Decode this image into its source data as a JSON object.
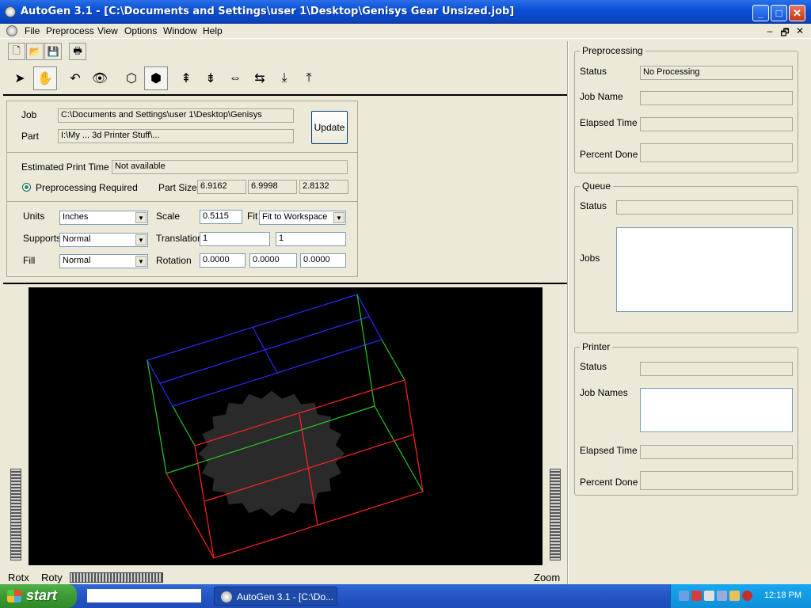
{
  "window": {
    "title": "AutoGen 3.1 - [C:\\Documents and Settings\\user 1\\Desktop\\Genisys          Gear Unsized.job]",
    "minimize": "_",
    "maximize": "□",
    "close": "✕"
  },
  "menu": {
    "items": [
      "File",
      "Preprocess",
      "View",
      "Options",
      "Window",
      "Help"
    ],
    "mdi_controls": [
      "–",
      "🗗",
      "✕"
    ]
  },
  "job_panel": {
    "job_label": "Job",
    "job_value": "C:\\Documents and Settings\\user 1\\Desktop\\Genisys",
    "part_label": "Part",
    "part_value": "I:\\My ... 3d Printer Stuff\\...",
    "update_label": "Update",
    "est_time_label": "Estimated Print Time",
    "est_time_value": "Not available",
    "preproc_label": "Preprocessing Required",
    "part_size_label": "Part Size",
    "part_size": [
      "6.9162",
      "6.9998",
      "2.8132"
    ],
    "units_label": "Units",
    "units_value": "Inches",
    "supports_label": "Supports",
    "supports_value": "Normal",
    "fill_label": "Fill",
    "fill_value": "Normal",
    "scale_label": "Scale",
    "scale_value": "0.5115",
    "fit_label": "Fit",
    "fit_value": "Fit to Workspace",
    "translation_label": "Translation",
    "translation": [
      "1",
      "1"
    ],
    "rotation_label": "Rotation",
    "rotation": [
      "0.0000",
      "0.0000",
      "0.0000"
    ]
  },
  "view": {
    "rotx_label": "Rotx",
    "roty_label": "Roty",
    "zoom_label": "Zoom"
  },
  "preprocessing": {
    "title": "Preprocessing",
    "status_label": "Status",
    "status_value": "No Processing",
    "job_name_label": "Job Name",
    "elapsed_label": "Elapsed Time",
    "percent_label": "Percent Done"
  },
  "queue": {
    "title": "Queue",
    "status_label": "Status",
    "jobs_label": "Jobs"
  },
  "printer": {
    "title": "Printer",
    "status_label": "Status",
    "job_names_label": "Job Names",
    "elapsed_label": "Elapsed Time",
    "percent_label": "Percent Done"
  },
  "taskbar": {
    "start_label": "start",
    "task_label": "AutoGen 3.1 - [C:\\Do...",
    "clock": "12:18 PM"
  },
  "colors": {
    "box_top": "#2a2aff",
    "box_side": "#22cc22",
    "box_bottom": "#ff2222",
    "gear": "#2a2a2a"
  }
}
